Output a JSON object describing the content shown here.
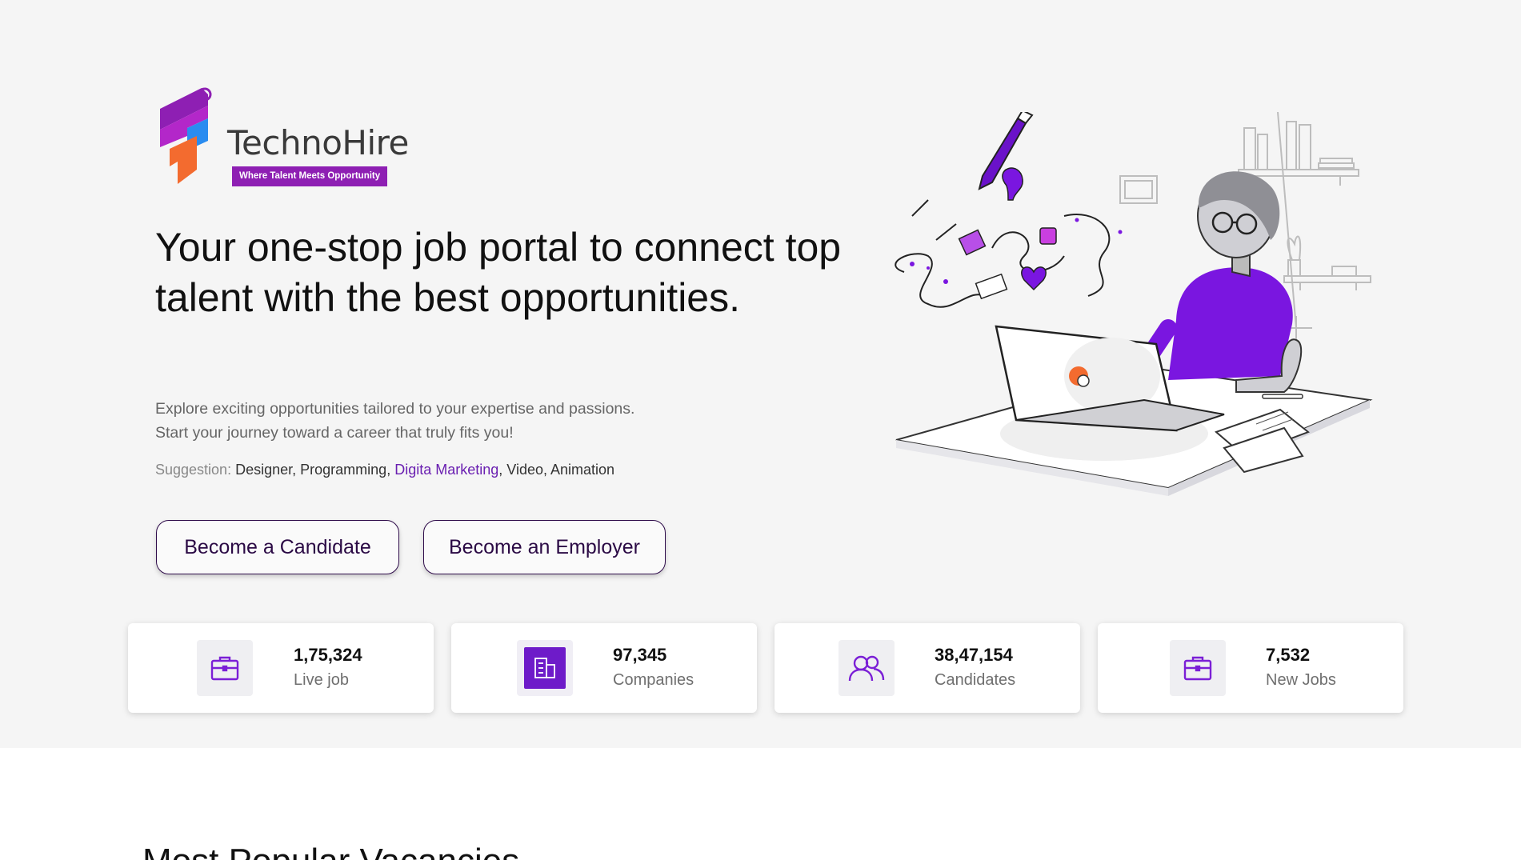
{
  "brand": {
    "name": "TechnoHire",
    "tagline": "Where Talent Meets Opportunity"
  },
  "hero": {
    "headline": "Your one-stop job portal to connect top talent with the best opportunities.",
    "subtitle": "Explore exciting opportunities tailored to your expertise and passions. Start your journey toward a career that truly fits you!",
    "suggestion_label": "Suggestion:",
    "suggestions": [
      "Designer,",
      "Programming,",
      "Digita Marketing",
      ", Video,",
      "Animation"
    ],
    "buttons": {
      "candidate": "Become a Candidate",
      "employer": "Become an Employer"
    }
  },
  "stats": [
    {
      "value": "1,75,324",
      "label": "Live job",
      "icon": "briefcase-icon"
    },
    {
      "value": "97,345",
      "label": "Companies",
      "icon": "building-icon"
    },
    {
      "value": "38,47,154",
      "label": "Candidates",
      "icon": "users-icon"
    },
    {
      "value": "7,532",
      "label": "New Jobs",
      "icon": "briefcase-icon"
    }
  ],
  "section": {
    "title": "Most Popular Vacancies"
  },
  "colors": {
    "accent": "#7b1fd6",
    "brand": "#8e1fb3",
    "button_border": "#2e0b4a",
    "hero_bg": "#f5f5f5"
  }
}
